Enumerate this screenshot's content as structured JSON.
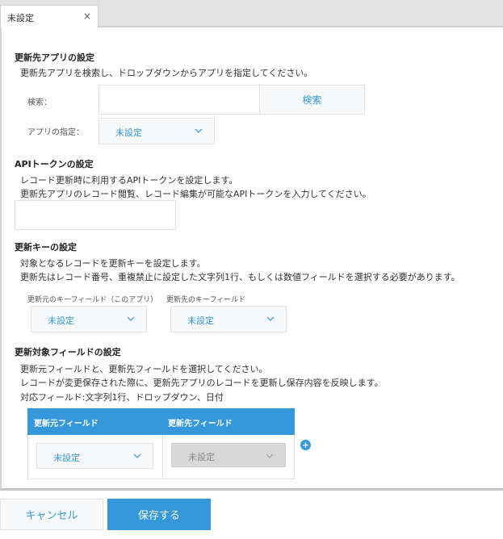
{
  "tab": {
    "label": "未設定",
    "close": "×"
  },
  "target_app": {
    "heading": "更新先アプリの設定",
    "description": "更新先アプリを検索し、ドロップダウンからアプリを指定してください。",
    "search_label": "検索：",
    "search_value": "",
    "search_button": "検索",
    "app_label": "アプリの指定：",
    "app_value": "未設定"
  },
  "api_token": {
    "heading": "APIトークンの設定",
    "line1": "レコード更新時に利用するAPIトークンを設定します。",
    "line2": "更新先アプリのレコード閲覧、レコード編集が可能なAPIトークンを入力してください。",
    "value": ""
  },
  "update_key": {
    "heading": "更新キーの設定",
    "line1": "対象となるレコードを更新キーを設定します。",
    "line2": "更新先はレコード番号、重複禁止に設定した文字列1行、もしくは数値フィールドを選択する必要があります。",
    "source_label": "更新元のキーフィールド（このアプリ）",
    "target_label": "更新先のキーフィールド",
    "source_value": "未設定",
    "target_value": "未設定"
  },
  "fields": {
    "heading": "更新対象フィールドの設定",
    "line1": "更新元フィールドと、更新先フィールドを選択してください。",
    "line2": "レコードが変更保存された際に、更新先アプリのレコードを更新し保存内容を反映します。",
    "line3": "対応フィールド:文字列1行、ドロップダウン、日付",
    "col_source": "更新元フィールド",
    "col_target": "更新先フィールド",
    "row_source_value": "未設定",
    "row_target_value": "未設定",
    "add": "+"
  },
  "footer": {
    "cancel": "キャンセル",
    "save": "保存する"
  },
  "colors": {
    "accent": "#3498db",
    "border": "#e3e3e3",
    "select_bg": "#f7f9fa",
    "disabled_bg": "#d8d8d8"
  }
}
